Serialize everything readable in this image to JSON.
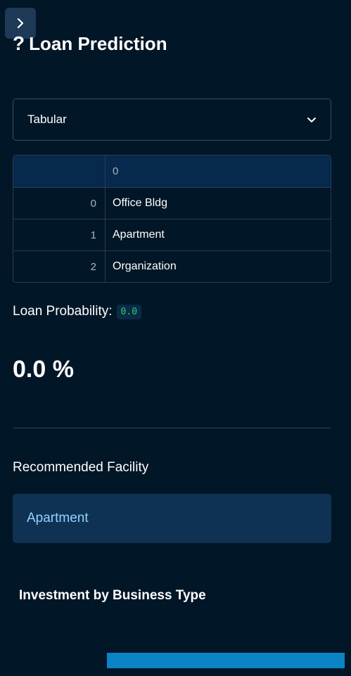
{
  "header": {
    "toggle_icon": "chevron-right-icon",
    "title_icon": "question-mark-icon",
    "title": "Loan Prediction"
  },
  "select": {
    "value": "Tabular",
    "icon": "chevron-down-icon"
  },
  "table": {
    "column_header": "0",
    "rows": [
      {
        "index": "0",
        "value": "Office Bldg"
      },
      {
        "index": "1",
        "value": "Apartment"
      },
      {
        "index": "2",
        "value": "Organization"
      }
    ]
  },
  "probability": {
    "label": "Loan Probability:",
    "code_value": "0.0"
  },
  "metric": {
    "value": "0.0 %"
  },
  "recommendation": {
    "label": "Recommended Facility",
    "value": "Apartment"
  },
  "chart": {
    "title": "Investment by Business Type"
  },
  "colors": {
    "background": "#011627",
    "info_box": "#0f3254",
    "info_text": "#8fd3ff",
    "code_text": "#2ecc71",
    "bar": "#0a84c4"
  }
}
